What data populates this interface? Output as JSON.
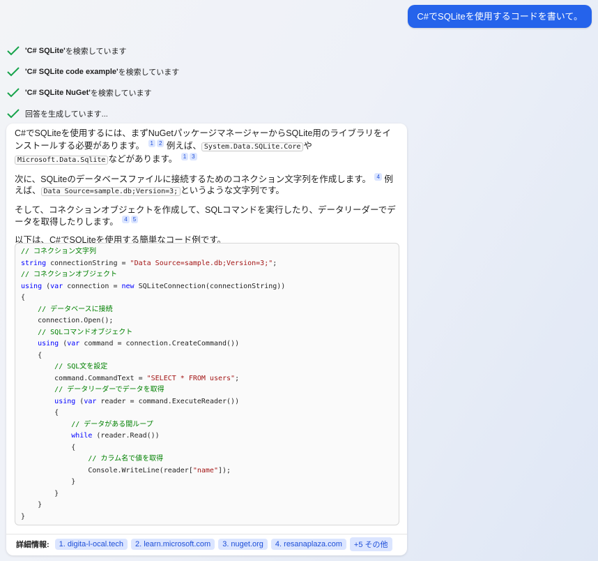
{
  "user_message": "C#でSQLiteを使用するコードを書いて。",
  "steps": [
    {
      "bold": "'C# SQLite'",
      "rest": " を検索しています"
    },
    {
      "bold": "'C# SQLite code example'",
      "rest": " を検索しています"
    },
    {
      "bold": "'C# SQLite NuGet'",
      "rest": " を検索しています"
    },
    {
      "bold": "",
      "rest": "回答を生成しています..."
    }
  ],
  "answer": {
    "p1_a": "C#でSQLiteを使用するには、まずNuGetパッケージマネージャーからSQLite用のライブラリをインストールする必要があります。",
    "p1_b": "例えば、",
    "p1_code1": "System.Data.SQLite.Core",
    "p1_c": "や",
    "p1_code2": "Microsoft.Data.Sqlite",
    "p1_d": "などがあります。",
    "p2_a": "次に、SQLiteのデータベースファイルに接続するためのコネクション文字列を作成します。",
    "p2_b": "例えば、",
    "p2_code": "Data Source=sample.db;Version=3;",
    "p2_c": "というような文字列です。",
    "p3": "そして、コネクションオブジェクトを作成して、SQLコマンドを実行したり、データリーダーでデータを取得したりします。",
    "p4": "以下は、C#でSQLiteを使用する簡単なコード例です。",
    "refs": [
      "1",
      "2",
      "1",
      "3",
      "4",
      "4",
      "5"
    ]
  },
  "code_lines": [
    [
      {
        "t": "// コネクション文字列",
        "c": "cm"
      }
    ],
    [
      {
        "t": "string",
        "c": "kw"
      },
      {
        "t": " connectionString = ",
        "c": ""
      },
      {
        "t": "\"Data Source=sample.db;Version=3;\"",
        "c": "st"
      },
      {
        "t": ";",
        "c": ""
      }
    ],
    [
      {
        "t": "// コネクションオブジェクト",
        "c": "cm"
      }
    ],
    [
      {
        "t": "using",
        "c": "kw"
      },
      {
        "t": " (",
        "c": ""
      },
      {
        "t": "var",
        "c": "kw"
      },
      {
        "t": " connection = ",
        "c": ""
      },
      {
        "t": "new",
        "c": "kw"
      },
      {
        "t": " SQLiteConnection(connectionString))",
        "c": ""
      }
    ],
    [
      {
        "t": "{",
        "c": ""
      }
    ],
    [
      {
        "t": "    ",
        "c": ""
      },
      {
        "t": "// データベースに接続",
        "c": "cm"
      }
    ],
    [
      {
        "t": "    connection.Open();",
        "c": ""
      }
    ],
    [
      {
        "t": "    ",
        "c": ""
      },
      {
        "t": "// SQLコマンドオブジェクト",
        "c": "cm"
      }
    ],
    [
      {
        "t": "    ",
        "c": ""
      },
      {
        "t": "using",
        "c": "kw"
      },
      {
        "t": " (",
        "c": ""
      },
      {
        "t": "var",
        "c": "kw"
      },
      {
        "t": " command = connection.CreateCommand())",
        "c": ""
      }
    ],
    [
      {
        "t": "    {",
        "c": ""
      }
    ],
    [
      {
        "t": "        ",
        "c": ""
      },
      {
        "t": "// SQL文を設定",
        "c": "cm"
      }
    ],
    [
      {
        "t": "        command.CommandText = ",
        "c": ""
      },
      {
        "t": "\"SELECT * FROM users\"",
        "c": "st"
      },
      {
        "t": ";",
        "c": ""
      }
    ],
    [
      {
        "t": "        ",
        "c": ""
      },
      {
        "t": "// データリーダーでデータを取得",
        "c": "cm"
      }
    ],
    [
      {
        "t": "        ",
        "c": ""
      },
      {
        "t": "using",
        "c": "kw"
      },
      {
        "t": " (",
        "c": ""
      },
      {
        "t": "var",
        "c": "kw"
      },
      {
        "t": " reader = command.ExecuteReader())",
        "c": ""
      }
    ],
    [
      {
        "t": "        {",
        "c": ""
      }
    ],
    [
      {
        "t": "            ",
        "c": ""
      },
      {
        "t": "// データがある間ループ",
        "c": "cm"
      }
    ],
    [
      {
        "t": "            ",
        "c": ""
      },
      {
        "t": "while",
        "c": "kw"
      },
      {
        "t": " (reader.Read())",
        "c": ""
      }
    ],
    [
      {
        "t": "            {",
        "c": ""
      }
    ],
    [
      {
        "t": "                ",
        "c": ""
      },
      {
        "t": "// カラム名で値を取得",
        "c": "cm"
      }
    ],
    [
      {
        "t": "                Console.WriteLine(reader[",
        "c": ""
      },
      {
        "t": "\"name\"",
        "c": "st"
      },
      {
        "t": "]);",
        "c": ""
      }
    ],
    [
      {
        "t": "            }",
        "c": ""
      }
    ],
    [
      {
        "t": "        }",
        "c": ""
      }
    ],
    [
      {
        "t": "    }",
        "c": ""
      }
    ],
    [
      {
        "t": "}",
        "c": ""
      }
    ]
  ],
  "footer": {
    "label": "詳細情報:",
    "links": [
      "1. digita-l-ocal.tech",
      "2. learn.microsoft.com",
      "3. nuget.org",
      "4. resanaplaza.com",
      "+5 その他"
    ]
  },
  "colors": {
    "accent": "#2563eb",
    "check": "#16a34a",
    "comment": "#008000",
    "keyword": "#0000ff",
    "string": "#a31515"
  }
}
